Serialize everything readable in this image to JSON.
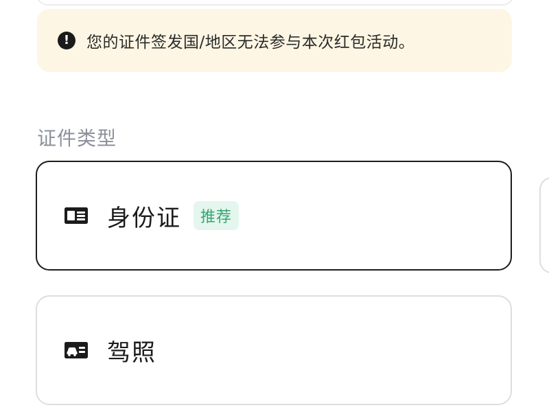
{
  "notice": {
    "icon": "exclamation-circle-icon",
    "icon_glyph": "!",
    "text": "您的证件签发国/地区无法参与本次红包活动。"
  },
  "document_type": {
    "section_label": "证件类型",
    "options": [
      {
        "icon": "id-card-icon",
        "label": "身份证",
        "badge": "推荐",
        "selected": true
      },
      {
        "icon": "drivers-license-icon",
        "label": "驾照",
        "selected": false
      }
    ]
  },
  "colors": {
    "notice_background": "#fdf6e4",
    "badge_background": "#e4f6ee",
    "badge_text": "#35a56f",
    "selected_border": "#1c1c1c",
    "unselected_border": "#dedede",
    "section_label": "#8b909a"
  }
}
